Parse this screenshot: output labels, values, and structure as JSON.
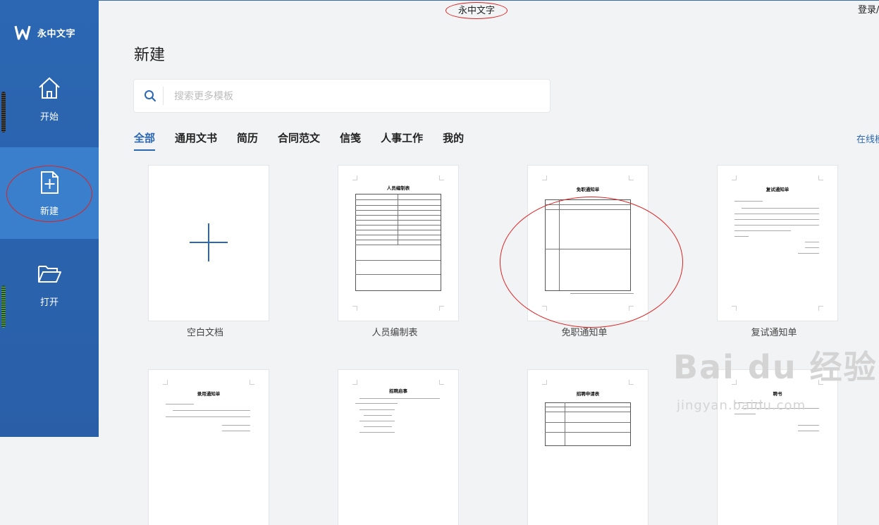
{
  "app": {
    "title": "永中文字",
    "login": "登录/"
  },
  "sidebar": {
    "brand": "永中文字",
    "items": [
      {
        "label": "开始",
        "icon": "home-icon"
      },
      {
        "label": "新建",
        "icon": "new-document-icon",
        "active": true
      },
      {
        "label": "打开",
        "icon": "folder-open-icon"
      }
    ]
  },
  "main": {
    "title": "新建",
    "search": {
      "placeholder": "搜索更多模板"
    },
    "tabs": [
      "全部",
      "通用文书",
      "简历",
      "合同范文",
      "信笺",
      "人事工作",
      "我的"
    ],
    "online_link": "在线模"
  },
  "templates": [
    {
      "label": "空白文档"
    },
    {
      "label": "人员编制表",
      "doc_title": "人员编制表"
    },
    {
      "label": "免职通知单",
      "doc_title": "免职通知单"
    },
    {
      "label": "复试通知单",
      "doc_title": "复试通知单"
    },
    {
      "label": "",
      "doc_title": "录用通知单"
    },
    {
      "label": "",
      "doc_title": "招聘启事"
    },
    {
      "label": "",
      "doc_title": "招聘申请表"
    },
    {
      "label": "",
      "doc_title": "聘书"
    }
  ],
  "watermark": {
    "main": "Bai du 经验",
    "sub": "jingyan.baidu.com"
  },
  "colors": {
    "sidebar": "#2b67b3",
    "sidebar_active": "#3a7fcc",
    "accent": "#2b67b3",
    "annotation": "#dd2222"
  }
}
